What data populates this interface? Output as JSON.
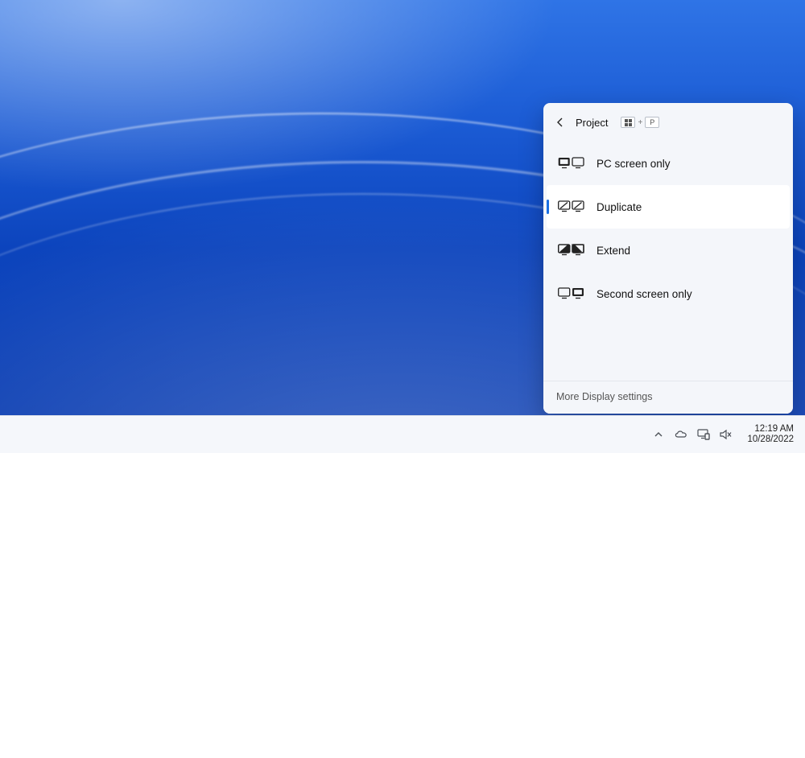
{
  "project_panel": {
    "title": "Project",
    "shortcut": {
      "plus": "+",
      "p": "P"
    },
    "options": [
      {
        "id": "pc-screen-only",
        "label": "PC screen only",
        "icon": "pc-screen-only-icon",
        "selected": false
      },
      {
        "id": "duplicate",
        "label": "Duplicate",
        "icon": "duplicate-icon",
        "selected": true
      },
      {
        "id": "extend",
        "label": "Extend",
        "icon": "extend-icon",
        "selected": false
      },
      {
        "id": "second-screen-only",
        "label": "Second screen only",
        "icon": "second-screen-only-icon",
        "selected": false
      }
    ],
    "footer_link": "More Display settings"
  },
  "taskbar": {
    "time": "12:19 AM",
    "date": "10/28/2022"
  }
}
